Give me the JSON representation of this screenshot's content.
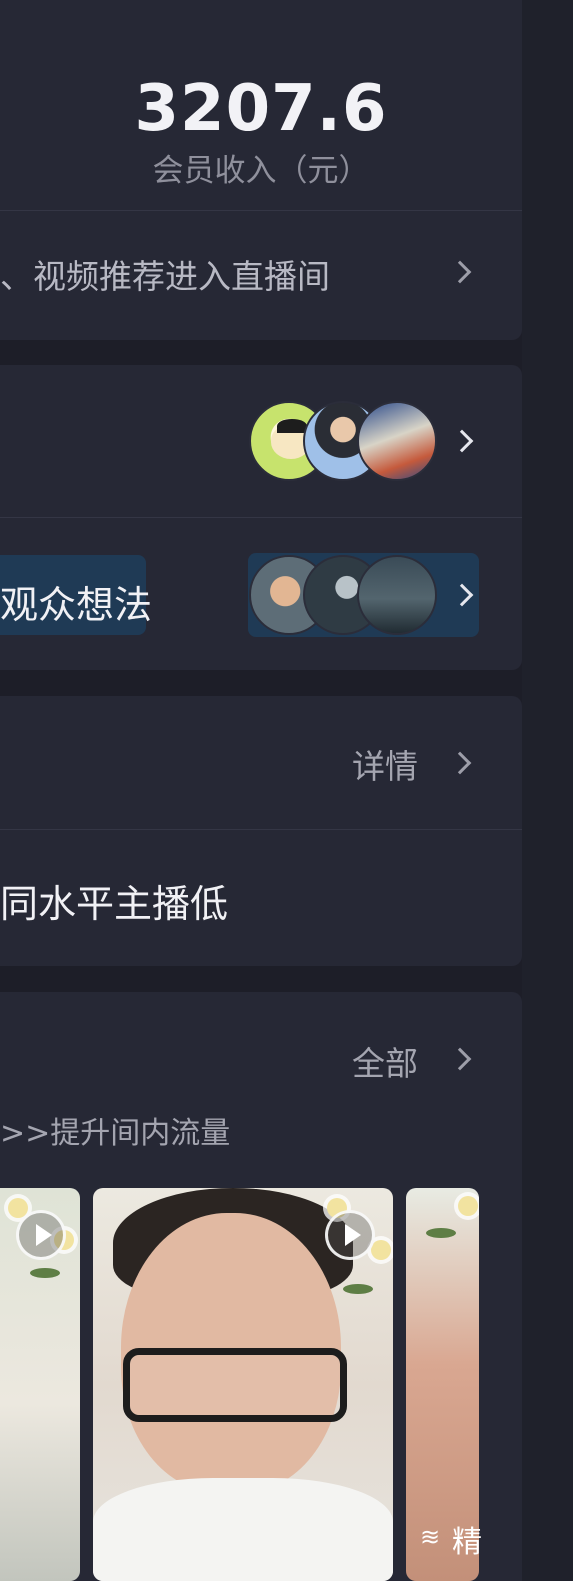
{
  "income": {
    "value": "3207.6",
    "label": "会员收入（元）"
  },
  "recommend_row": {
    "text": "、视频推荐进入直播间"
  },
  "audience_row": {
    "avatars": [
      "crayon-shin-chan-avatar",
      "football-player-avatar",
      "banner-avatar"
    ]
  },
  "thoughts_row": {
    "text": "观众想法",
    "avatars": [
      "child-avatar",
      "moon-avatar",
      "landscape-avatar"
    ]
  },
  "detail_section": {
    "detail_label": "详情",
    "comparison_text": "同水平主播低"
  },
  "videos_section": {
    "all_label": "全部",
    "hint_text": ">>提升间内流量",
    "featured_label": "精"
  },
  "colors": {
    "background": "#1d1e28",
    "card": "#262835",
    "highlight": "#1f3a55",
    "primary_text": "#f1f1f5",
    "secondary_text": "#a4a5b0"
  }
}
